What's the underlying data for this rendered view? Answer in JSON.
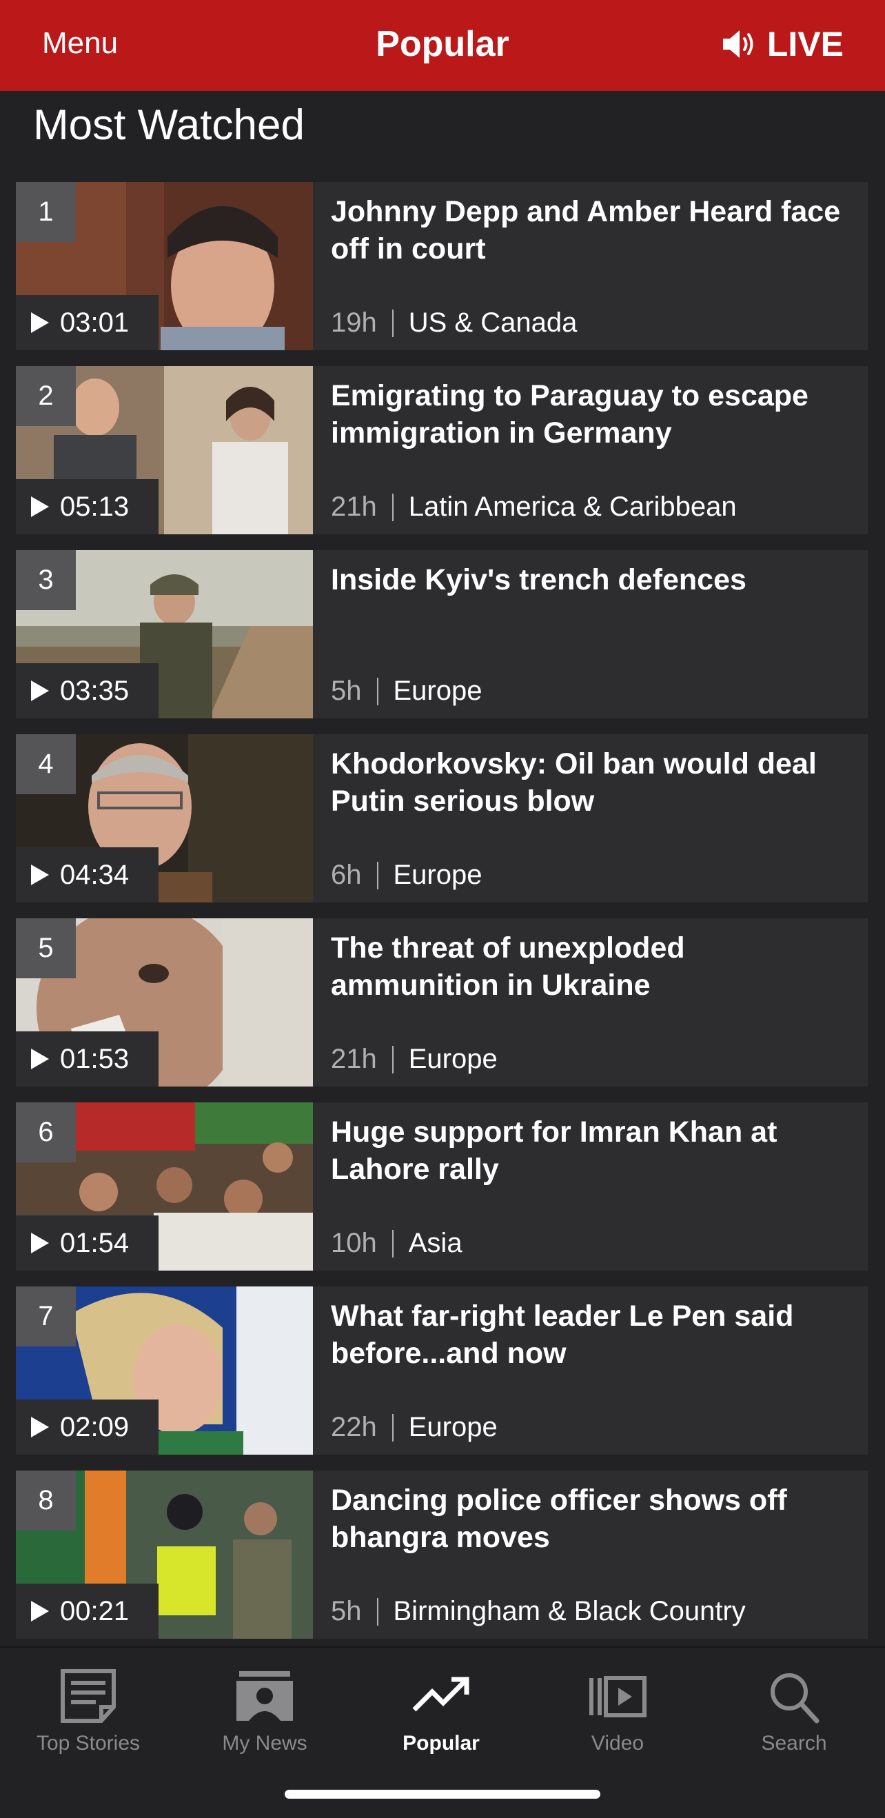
{
  "header": {
    "menu_label": "Menu",
    "title": "Popular",
    "live_label": "LIVE",
    "live_icon": "speaker-icon",
    "brand_color": "#bb1919"
  },
  "section_title": "Most Watched",
  "videos": [
    {
      "rank": "1",
      "duration": "03:01",
      "title": "Johnny Depp and Amber Heard face off in court",
      "age": "19h",
      "region": "US & Canada"
    },
    {
      "rank": "2",
      "duration": "05:13",
      "title": "Emigrating to Paraguay to escape immigration in Germany",
      "age": "21h",
      "region": "Latin America & Caribbean"
    },
    {
      "rank": "3",
      "duration": "03:35",
      "title": "Inside Kyiv's trench defences",
      "age": "5h",
      "region": "Europe"
    },
    {
      "rank": "4",
      "duration": "04:34",
      "title": "Khodorkovsky: Oil ban would deal Putin serious blow",
      "age": "6h",
      "region": "Europe"
    },
    {
      "rank": "5",
      "duration": "01:53",
      "title": "The threat of unexploded ammunition in Ukraine",
      "age": "21h",
      "region": "Europe"
    },
    {
      "rank": "6",
      "duration": "01:54",
      "title": "Huge support for Imran Khan at Lahore rally",
      "age": "10h",
      "region": "Asia"
    },
    {
      "rank": "7",
      "duration": "02:09",
      "title": "What far-right leader Le Pen said before...and now",
      "age": "22h",
      "region": "Europe"
    },
    {
      "rank": "8",
      "duration": "00:21",
      "title": "Dancing police officer shows off bhangra moves",
      "age": "5h",
      "region": "Birmingham & Black Country"
    }
  ],
  "tabs": [
    {
      "label": "Top Stories",
      "icon": "newspaper-icon"
    },
    {
      "label": "My News",
      "icon": "person-news-icon"
    },
    {
      "label": "Popular",
      "icon": "trending-icon",
      "active": true
    },
    {
      "label": "Video",
      "icon": "video-icon"
    },
    {
      "label": "Search",
      "icon": "search-icon"
    }
  ]
}
